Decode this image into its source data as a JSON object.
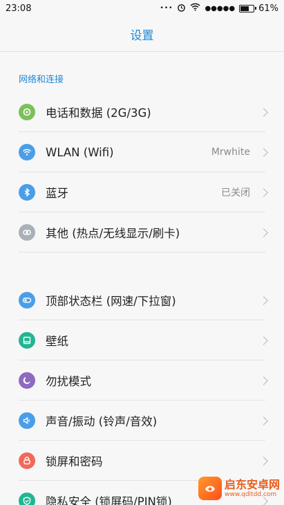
{
  "status_bar": {
    "time": "23:08",
    "dots": "•••",
    "signal": "●●●●●",
    "battery": "61%",
    "battery_level": 0.61
  },
  "header": {
    "title": "设置"
  },
  "section1": {
    "title": "网络和连接"
  },
  "section1_items": [
    {
      "label": "电话和数据 (2G/3G)",
      "value": "",
      "icon": "phone-data-icon",
      "color": "#7cc05b"
    },
    {
      "label": "WLAN (Wifi)",
      "value": "Mrwhite",
      "icon": "wifi-icon",
      "color": "#4a9ee8"
    },
    {
      "label": "蓝牙",
      "value": "已关闭",
      "icon": "bluetooth-icon",
      "color": "#4a9ee8"
    },
    {
      "label": "其他 (热点/无线显示/刷卡)",
      "value": "",
      "icon": "link-icon",
      "color": "#a9b0b7"
    }
  ],
  "section2_items": [
    {
      "label": "顶部状态栏 (网速/下拉窗)",
      "value": "",
      "icon": "toggle-icon",
      "color": "#4a9ee8"
    },
    {
      "label": "壁纸",
      "value": "",
      "icon": "wallpaper-icon",
      "color": "#23b591"
    },
    {
      "label": "勿扰模式",
      "value": "",
      "icon": "moon-icon",
      "color": "#8f6ac0"
    },
    {
      "label": "声音/振动 (铃声/音效)",
      "value": "",
      "icon": "speaker-icon",
      "color": "#4a9ee8"
    },
    {
      "label": "锁屏和密码",
      "value": "",
      "icon": "lock-icon",
      "color": "#f06a5a"
    },
    {
      "label": "隐私安全 (锁屏码/PIN锁)",
      "value": "",
      "icon": "shield-icon",
      "color": "#23b591"
    }
  ],
  "watermark": {
    "title": "启东安卓网",
    "subtitle": "www.qdltdd.com"
  }
}
